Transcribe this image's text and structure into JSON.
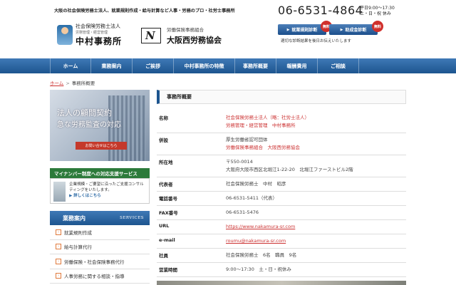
{
  "header": {
    "tagline": "大阪の社会保険労務士法人、就業規則作成・給与計算など人事・労務のプロ・社労士事務所",
    "logo1": {
      "line1": "社会保険労務士法人",
      "line2": "労務管理・経営管理",
      "line3": "中村事務所"
    },
    "logo2": {
      "mark": "N",
      "line1": "労働保険事務組合",
      "line2": "大阪西労務協会"
    },
    "phone": "06-6531-4864",
    "hours_line1": "平日9:00〜17:30",
    "hours_line2": "土・日・祝 休み",
    "btn1_label": "就業規則診断",
    "btn2_label": "助成金診断",
    "badge": "無料",
    "note": "適切な診断結果を後日お伝えいたします"
  },
  "nav": {
    "items": [
      "ホーム",
      "業務案内",
      "ご挨拶",
      "中村事務所の特徴",
      "事務所概要",
      "報酬費用",
      "ご相談"
    ]
  },
  "breadcrumb": {
    "home": "ホーム",
    "current": "事務所概要"
  },
  "sidebar": {
    "banner": {
      "line1": "法人の顧問契約",
      "line2": "急な労務監査の対応",
      "button": "お問い合せはこちら"
    },
    "mynumber": {
      "head": "マイナンバー制度への対応支援サービス",
      "text": "企業規模・ご要望に沿ったご支援コンサルティングをいたします。",
      "more": "詳しくはこちら"
    },
    "services": {
      "title": "業務案内",
      "subtitle": "SERVICES",
      "items": [
        "就業規則作成",
        "給与計算代行",
        "労働保険・社会保険事務代行",
        "人事労務に関する相談・指導"
      ]
    }
  },
  "main": {
    "section_title": "事務所概要",
    "rows": [
      {
        "key": "名称",
        "lines": [
          "社会保険労務士法人（略：社労士法人）",
          "労務管理・経営管理　中村事務所"
        ],
        "style": "link"
      },
      {
        "key": "併設",
        "lines": [
          "厚生労働省認可団体",
          "労働保険事務組合　大阪西労務協会"
        ],
        "style": "mixed"
      },
      {
        "key": "所在地",
        "lines": [
          "〒550-0014",
          "大阪府大阪市西区北堀江1-22-20　北堀江ファーストビル2階"
        ],
        "style": "plain"
      },
      {
        "key": "代表者",
        "lines": [
          "社会保険労務士　中村　昭彦"
        ],
        "style": "plain"
      },
      {
        "key": "電話番号",
        "lines": [
          "06-6531-5411（代表）"
        ],
        "style": "plain"
      },
      {
        "key": "FAX番号",
        "lines": [
          "06-6531-5476"
        ],
        "style": "plain"
      },
      {
        "key": "URL",
        "lines": [
          "https://www.nakamura-sr.com"
        ],
        "style": "url"
      },
      {
        "key": "e-mail",
        "lines": [
          "roumu@nakamura-sr.com"
        ],
        "style": "url"
      },
      {
        "key": "社員",
        "lines": [
          "社会保険労務士　6名　職員　9名"
        ],
        "style": "plain"
      },
      {
        "key": "営業時間",
        "lines": [
          "9:00〜17:30　土・日・祝休み"
        ],
        "style": "plain"
      }
    ]
  },
  "colors": {
    "nav": "#1d558f",
    "accent_red": "#c33",
    "green": "#2c7a3a",
    "orange": "#e07a3c"
  }
}
